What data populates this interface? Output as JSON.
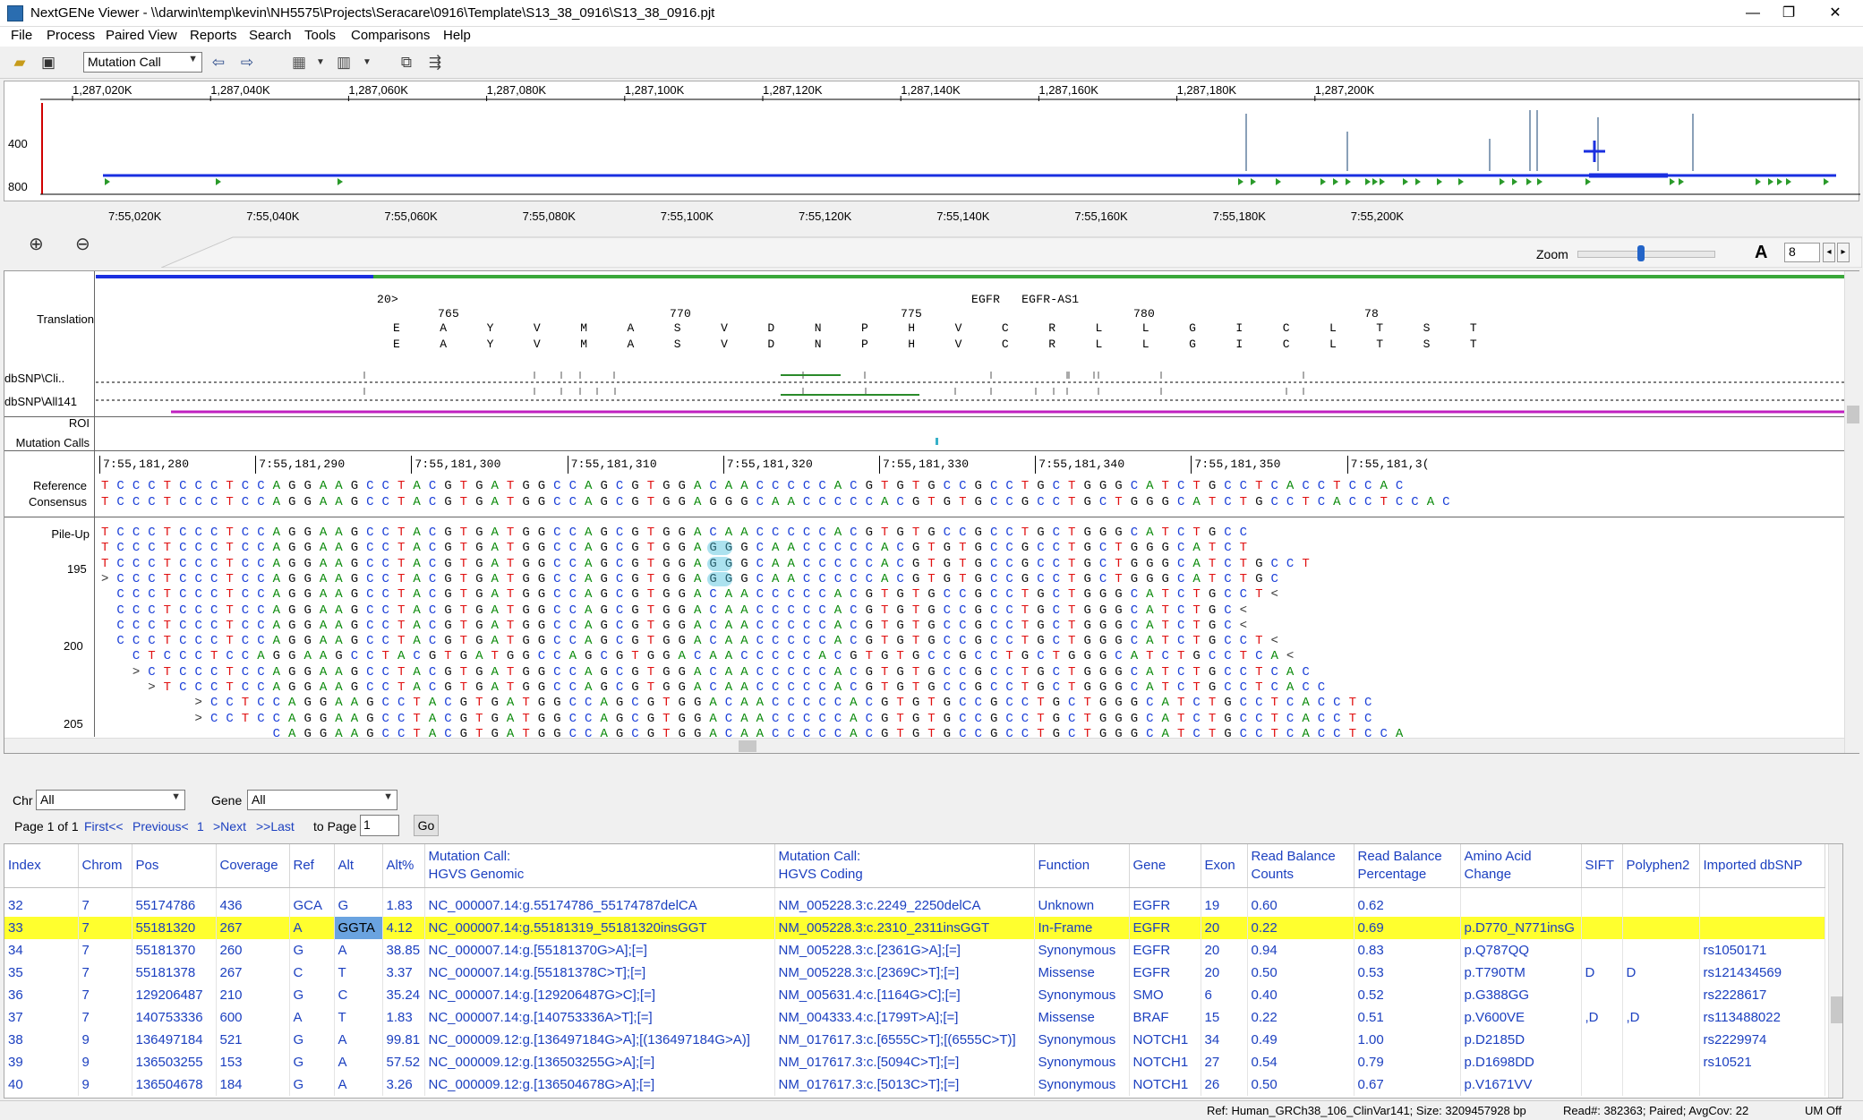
{
  "window": {
    "title": "NextGENe Viewer - \\\\darwin\\temp\\kevin\\NH5575\\Projects\\Seracare\\0916\\Template\\S13_38_0916\\S13_38_0916.pjt",
    "minimize": "—",
    "restore": "❐",
    "close": "✕"
  },
  "menu": [
    "File",
    "Process",
    "Paired View",
    "Reports",
    "Search",
    "Tools",
    "Comparisons",
    "Help"
  ],
  "toolbar": {
    "mode_select": "Mutation Call"
  },
  "overview": {
    "top_ticks": [
      "1,287,020K",
      "1,287,040K",
      "1,287,060K",
      "1,287,080K",
      "1,287,100K",
      "1,287,120K",
      "1,287,140K",
      "1,287,160K",
      "1,287,180K",
      "1,287,200K"
    ],
    "y_ticks": [
      "400",
      "800"
    ],
    "bottom_ticks": [
      "7:55,020K",
      "7:55,040K",
      "7:55,060K",
      "7:55,080K",
      "7:55,100K",
      "7:55,120K",
      "7:55,140K",
      "7:55,160K",
      "7:55,180K",
      "7:55,200K"
    ],
    "coverage_spikes": [
      {
        "x": 1387,
        "h": 0.8
      },
      {
        "x": 1500,
        "h": 0.55
      },
      {
        "x": 1659,
        "h": 0.45
      },
      {
        "x": 1704,
        "h": 0.85
      },
      {
        "x": 1712,
        "h": 0.85
      },
      {
        "x": 1780,
        "h": 0.75
      },
      {
        "x": 1886,
        "h": 0.8
      }
    ]
  },
  "zoom": {
    "label": "Zoom",
    "font_size": "8",
    "zoom_level": 0.45
  },
  "main": {
    "tracks": {
      "translation": "Translation",
      "dbsnp_cli": "dbSNP\\Cli..",
      "dbsnp_all": "dbSNP\\All141",
      "roi": "ROI",
      "mutation_calls": "Mutation Calls",
      "reference": "Reference",
      "consensus": "Consensus",
      "pileup": "Pile-Up"
    },
    "exon_label": "20>",
    "gene_labels": "EGFR   EGFR-AS1",
    "codon_numbers": [
      {
        "label": "765",
        "x": 484
      },
      {
        "label": "770",
        "x": 743
      },
      {
        "label": "775",
        "x": 1001
      },
      {
        "label": "780",
        "x": 1261
      },
      {
        "label": "78",
        "x": 1519
      }
    ],
    "aa_row": "E A Y V M A S V D N P H V C R L L G I C L T S T",
    "pos_labels": [
      "7:55,181,280",
      "7:55,181,290",
      "7:55,181,300",
      "7:55,181,310",
      "7:55,181,320",
      "7:55,181,330",
      "7:55,181,340",
      "7:55,181,350",
      "7:55,181,3("
    ],
    "reference_seq": "TCCCTCCCTCCAGGAAGCCTACGTGATGGCCAGCGTGGACAACCCCCACGTGTGCCGCCTGCTGGGCATCTGCCTCACCTCCAC",
    "consensus_seq": "TCCCTCCCTCCAGGAAGCCTACGTGATGGCCAGCGTGGAGGGCAACCCCCACGTGTGCCGCCTGCTGGGCATCTGCCTCACCTCCAC",
    "pileup_row_numbers": [
      {
        "label": "195",
        "row": 2
      },
      {
        "label": "200",
        "row": 7
      },
      {
        "label": "205",
        "row": 12
      }
    ],
    "pileup": [
      {
        "offset": 0,
        "seq": "TCCCTCCCTCCAGGAAGCCTACGTGATGGCCAGCGTGGACAACCCCCACGTGTGCCGCCTGCTGGGCATCTGCC"
      },
      {
        "offset": 0,
        "seq": "TCCCTCCCTCCAGGAAGCCTACGTGATGGCCAGCGTGGAGGGCAACCCCCACGTGTGCCGCCTGCTGGGCATCT"
      },
      {
        "offset": 0,
        "seq": "TCCCTCCCTCCAGGAAGCCTACGTGATGGCCAGCGTGGAGGGCAACCCCCACGTGTGCCGCCTGCTGGGCATCTGCCT"
      },
      {
        "offset": 0,
        "seq": ">CCCTCCCTCCAGGAAGCCTACGTGATGGCCAGCGTGGAGGGCAACCCCCACGTGTGCCGCCTGCTGGGCATCTGC"
      },
      {
        "offset": 1,
        "seq": "CCCTCCCTCCAGGAAGCCTACGTGATGGCCAGCGTGGACAACCCCCACGTGTGCCGCCTGCTGGGCATCTGCCT<"
      },
      {
        "offset": 1,
        "seq": "CCCTCCCTCCAGGAAGCCTACGTGATGGCCAGCGTGGACAACCCCCACGTGTGCCGCCTGCTGGGCATCTGC<"
      },
      {
        "offset": 1,
        "seq": "CCCTCCCTCCAGGAAGCCTACGTGATGGCCAGCGTGGACAACCCCCACGTGTGCCGCCTGCTGGGCATCTGC<"
      },
      {
        "offset": 1,
        "seq": "CCCTCCCTCCAGGAAGCCTACGTGATGGCCAGCGTGGACAACCCCCACGTGTGCCGCCTGCTGGGCATCTGCCT<"
      },
      {
        "offset": 2,
        "seq": "CTCCCTCCAGGAAGCCTACGTGATGGCCAGCGTGGACAACCCCCACGTGTGCCGCCTGCTGGGCATCTGCCTCA<"
      },
      {
        "offset": 2,
        "seq": ">CTCCCTCCAGGAAGCCTACGTGATGGCCAGCGTGGACAACCCCCACGTGTGCCGCCTGCTGGGCATCTGCCTCAC"
      },
      {
        "offset": 3,
        "seq": ">TCCCTCCAGGAAGCCTACGTGATGGCCAGCGTGGACAACCCCCACGTGTGCCGCCTGCTGGGCATCTGCCTCACC"
      },
      {
        "offset": 6,
        "seq": ">CCTCCAGGAAGCCTACGTGATGGCCAGCGTGGACAACCCCCACGTGTGCCGCCTGCTGGGCATCTGCCTCACCTC"
      },
      {
        "offset": 6,
        "seq": ">CCTCCAGGAAGCCTACGTGATGGCCAGCGTGGACAACCCCCACGTGTGCCGCCTGCTGGGCATCTGCCTCACCTC"
      },
      {
        "offset": 11,
        "seq": "CAGGAAGCCTACGTGATGGCCAGCGTGGACAACCCCCACGTGTGCCGCCTGCTGGGCATCTGCCTCACCTCCAC"
      },
      {
        "offset": 10,
        "seq": ">CAGGAAGCCTACGTGATGGCCAGCGTGGACAACCCCCACGTGTGCCGCCTGCTGGGCATCTGCCTCACCTCCAC"
      }
    ]
  },
  "filters": {
    "chr_label": "Chr",
    "chr_value": "All",
    "gene_label": "Gene",
    "gene_value": "All",
    "page_info": "Page 1 of 1",
    "first": "First<<",
    "previous": "Previous<",
    "page_num": "1",
    "next": ">Next",
    "last": ">>Last",
    "to_page_label": "to Page",
    "to_page_value": "1",
    "go": "Go"
  },
  "table": {
    "headers": [
      "Index",
      "Chrom",
      "Pos",
      "Coverage",
      "Ref",
      "Alt",
      "Alt%",
      "Mutation Call:\nHGVS Genomic",
      "Mutation Call:\nHGVS Coding",
      "Function",
      "Gene",
      "Exon",
      "Read Balance\nCounts",
      "Read Balance\nPercentage",
      "Amino Acid\nChange",
      "SIFT",
      "Polyphen2",
      "Imported dbSNP"
    ],
    "rows": [
      [
        "32",
        "7",
        "55174786",
        "436",
        "GCA",
        "G",
        "1.83",
        "NC_000007.14:g.55174786_55174787delCA",
        "NM_005228.3:c.2249_2250delCA",
        "Unknown",
        "EGFR",
        "19",
        "0.60",
        "0.62",
        "",
        "",
        "",
        ""
      ],
      [
        "33",
        "7",
        "55181320",
        "267",
        "A",
        "GGTA",
        "4.12",
        "NC_000007.14:g.55181319_55181320insGGT",
        "NM_005228.3:c.2310_2311insGGT",
        "In-Frame",
        "EGFR",
        "20",
        "0.22",
        "0.69",
        "p.D770_N771insG",
        "",
        "",
        ""
      ],
      [
        "34",
        "7",
        "55181370",
        "260",
        "G",
        "A",
        "38.85",
        "NC_000007.14:g.[55181370G>A];[=]",
        "NM_005228.3:c.[2361G>A];[=]",
        "Synonymous",
        "EGFR",
        "20",
        "0.94",
        "0.83",
        "p.Q787QQ",
        "",
        "",
        "rs1050171"
      ],
      [
        "35",
        "7",
        "55181378",
        "267",
        "C",
        "T",
        "3.37",
        "NC_000007.14:g.[55181378C>T];[=]",
        "NM_005228.3:c.[2369C>T];[=]",
        "Missense",
        "EGFR",
        "20",
        "0.50",
        "0.53",
        "p.T790TM",
        "D",
        "D",
        "rs121434569"
      ],
      [
        "36",
        "7",
        "129206487",
        "210",
        "G",
        "C",
        "35.24",
        "NC_000007.14:g.[129206487G>C];[=]",
        "NM_005631.4:c.[1164G>C];[=]",
        "Synonymous",
        "SMO",
        "6",
        "0.40",
        "0.52",
        "p.G388GG",
        "",
        "",
        "rs2228617"
      ],
      [
        "37",
        "7",
        "140753336",
        "600",
        "A",
        "T",
        "1.83",
        "NC_000007.14:g.[140753336A>T];[=]",
        "NM_004333.4:c.[1799T>A];[=]",
        "Missense",
        "BRAF",
        "15",
        "0.22",
        "0.51",
        "p.V600VE",
        ",D",
        ",D",
        "rs113488022"
      ],
      [
        "38",
        "9",
        "136497184",
        "521",
        "G",
        "A",
        "99.81",
        "NC_000009.12:g.[136497184G>A];[(136497184G>A)]",
        "NM_017617.3:c.[6555C>T];[(6555C>T)]",
        "Synonymous",
        "NOTCH1",
        "34",
        "0.49",
        "1.00",
        "p.D2185D",
        "",
        "",
        "rs2229974"
      ],
      [
        "39",
        "9",
        "136503255",
        "153",
        "G",
        "A",
        "57.52",
        "NC_000009.12:g.[136503255G>A];[=]",
        "NM_017617.3:c.[5094C>T];[=]",
        "Synonymous",
        "NOTCH1",
        "27",
        "0.54",
        "0.79",
        "p.D1698DD",
        "",
        "",
        "rs10521"
      ],
      [
        "40",
        "9",
        "136504678",
        "184",
        "G",
        "A",
        "3.26",
        "NC_000009.12:g.[136504678G>A];[=]",
        "NM_017617.3:c.[5013C>T];[=]",
        "Synonymous",
        "NOTCH1",
        "26",
        "0.50",
        "0.67",
        "p.V1671VV",
        "",
        "",
        ""
      ]
    ]
  },
  "status": {
    "ref": "Ref: Human_GRCh38_106_ClinVar141; Size: 3209457928 bp",
    "reads": "Read#: 382363; Paired; AvgCov: 22",
    "um": "UM Off"
  },
  "colors": {
    "A": "#0a8a0a",
    "C": "#1b3fd8",
    "G": "#111111",
    "T": "#e01010",
    "selected_row": "#ffff2e",
    "link": "#1c40c0"
  }
}
